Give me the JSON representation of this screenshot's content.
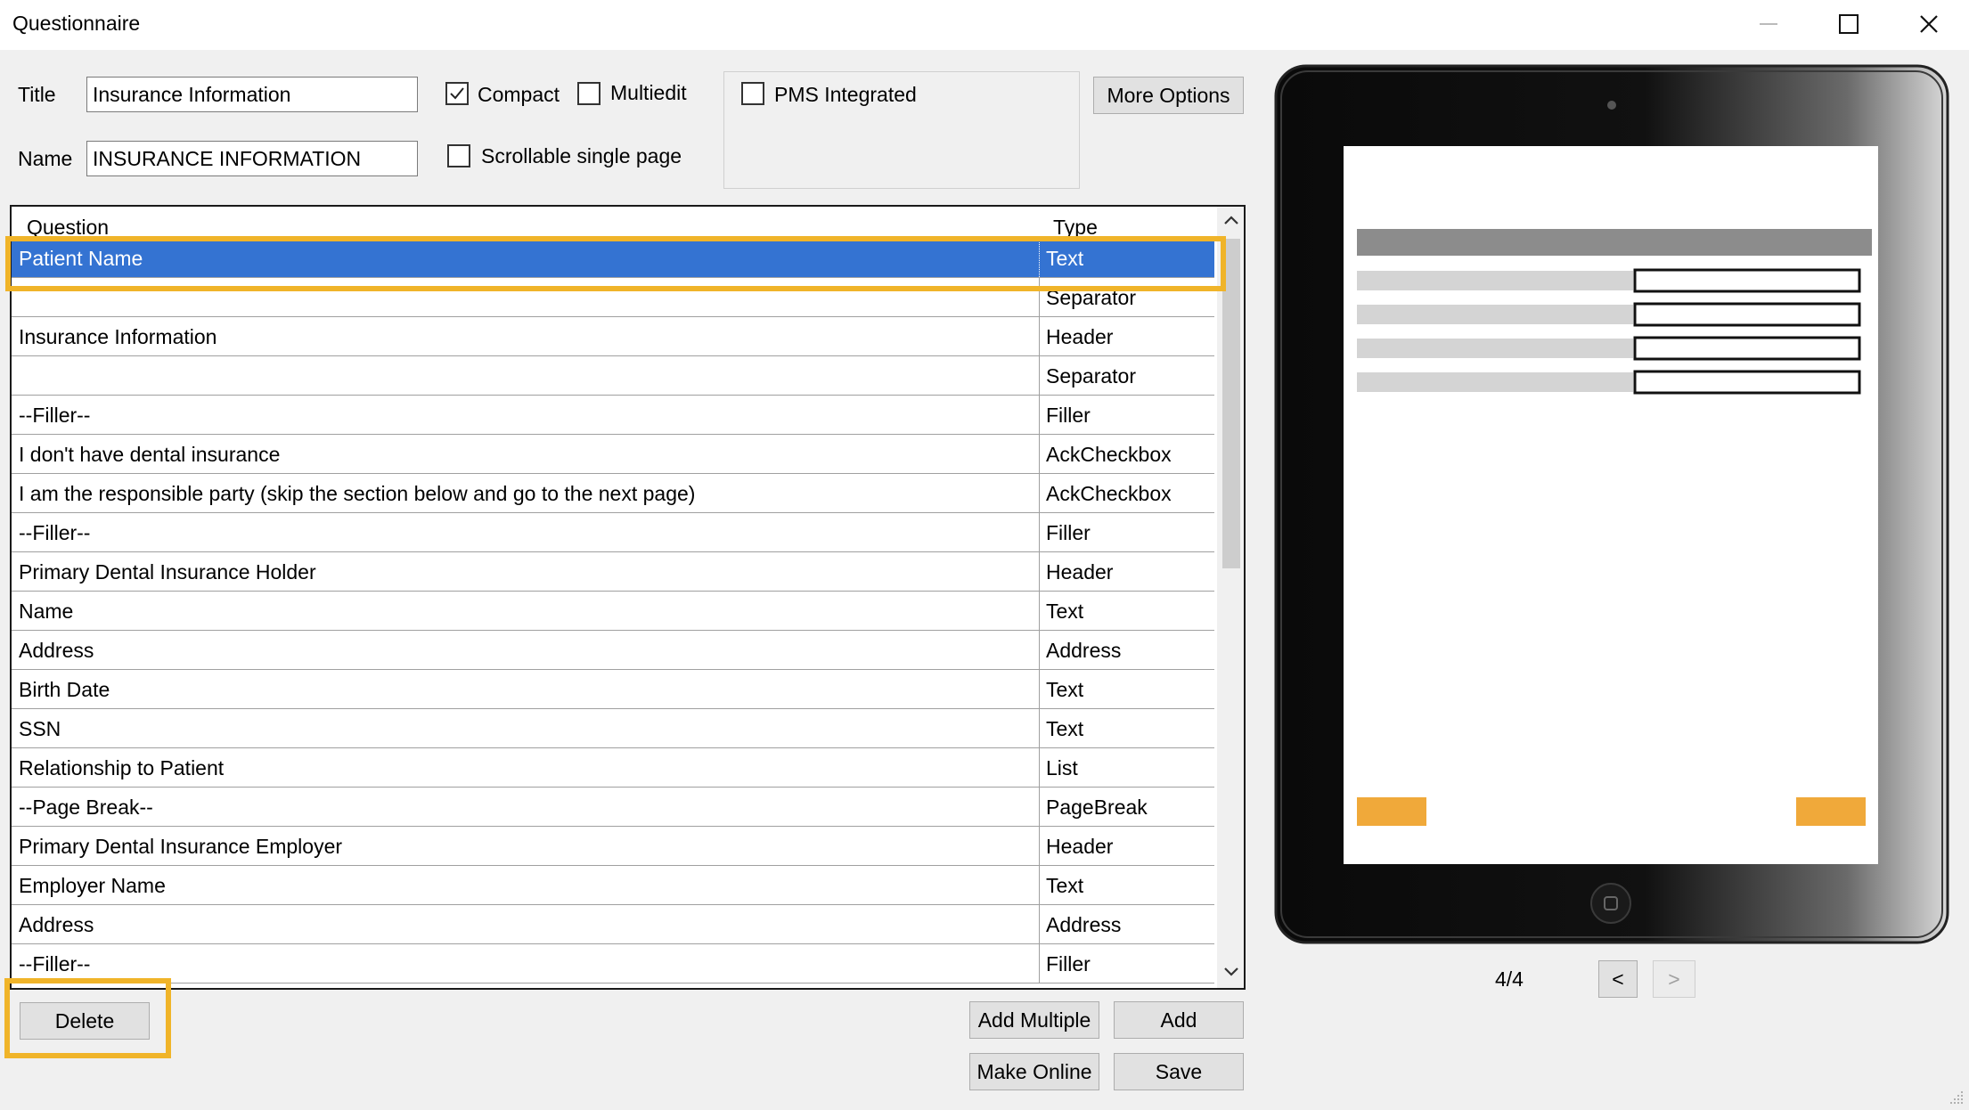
{
  "window": {
    "title": "Questionnaire",
    "controls": {
      "minimize": "—",
      "maximize": "☐",
      "close": "✕"
    }
  },
  "form": {
    "title_label": "Title",
    "title_value": "Insurance Information",
    "name_label": "Name",
    "name_value": "INSURANCE INFORMATION",
    "compact": {
      "label": "Compact",
      "checked": true
    },
    "multiedit": {
      "label": "Multiedit",
      "checked": false
    },
    "scrollable": {
      "label": "Scrollable single page",
      "checked": false
    },
    "pms": {
      "label": "PMS Integrated",
      "checked": false
    },
    "more_options": "More Options"
  },
  "grid": {
    "columns": [
      "Question",
      "Type"
    ],
    "selected_index": 0,
    "rows": [
      {
        "question": "Patient Name",
        "type": "Text"
      },
      {
        "question": "",
        "type": "Separator"
      },
      {
        "question": "Insurance Information",
        "type": "Header"
      },
      {
        "question": "",
        "type": "Separator"
      },
      {
        "question": "--Filler--",
        "type": "Filler"
      },
      {
        "question": "I don't have dental insurance",
        "type": "AckCheckbox"
      },
      {
        "question": "I am the responsible party (skip the section below and go to the next page)",
        "type": "AckCheckbox"
      },
      {
        "question": "--Filler--",
        "type": "Filler"
      },
      {
        "question": "Primary Dental Insurance Holder",
        "type": "Header"
      },
      {
        "question": "Name",
        "type": "Text"
      },
      {
        "question": "Address",
        "type": "Address"
      },
      {
        "question": "Birth Date",
        "type": "Text"
      },
      {
        "question": "SSN",
        "type": "Text"
      },
      {
        "question": "Relationship to Patient",
        "type": "List"
      },
      {
        "question": "--Page Break--",
        "type": "PageBreak"
      },
      {
        "question": "Primary Dental Insurance Employer",
        "type": "Header"
      },
      {
        "question": "Employer Name",
        "type": "Text"
      },
      {
        "question": "Address",
        "type": "Address"
      },
      {
        "question": "--Filler--",
        "type": "Filler"
      }
    ]
  },
  "buttons": {
    "delete": "Delete",
    "add_multiple": "Add Multiple",
    "add": "Add",
    "make_online": "Make Online",
    "save": "Save"
  },
  "preview": {
    "page_indicator": "4/4",
    "prev": "<",
    "next": ">",
    "accent_color": "#f0a93a",
    "field_rows": 4
  },
  "highlight_color": "#f0b429",
  "selection_color": "#3473d2"
}
